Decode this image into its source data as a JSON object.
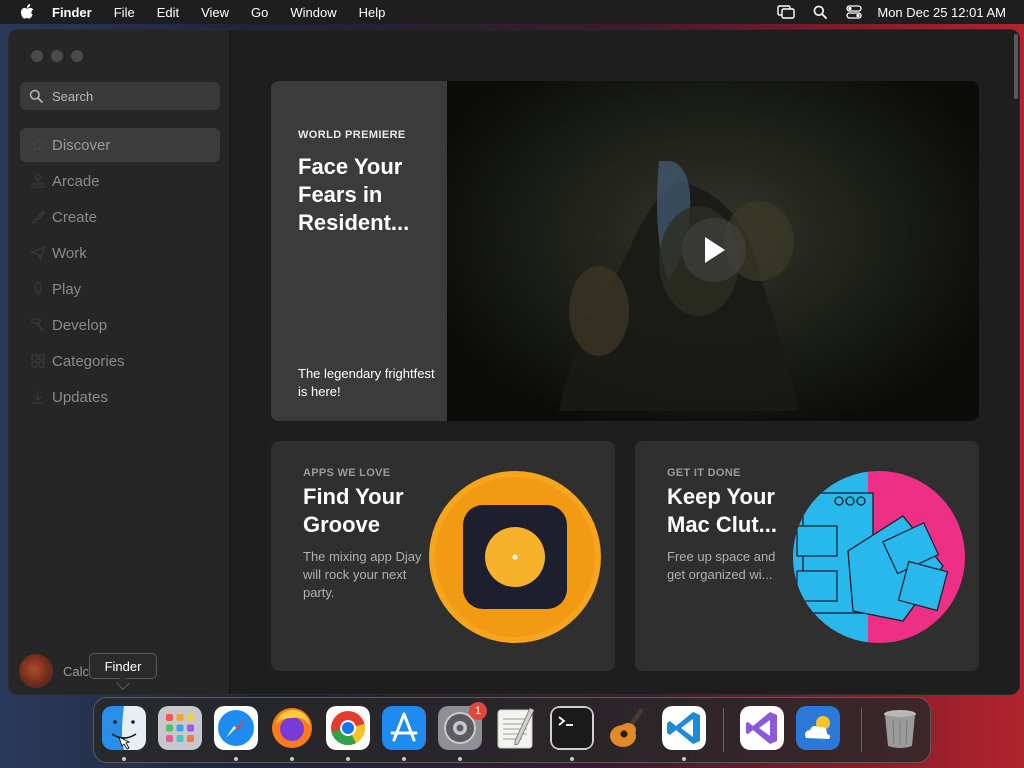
{
  "menubar": {
    "app_name": "Finder",
    "menus": [
      "File",
      "Edit",
      "View",
      "Go",
      "Window",
      "Help"
    ],
    "clock": "Mon Dec 25  12:01 AM",
    "status_icons": [
      "screen-mirroring-icon",
      "spotlight-search-icon",
      "control-center-icon"
    ]
  },
  "sidebar": {
    "search_placeholder": "Search",
    "items": [
      {
        "label": "Discover",
        "icon": "star-icon",
        "active": true
      },
      {
        "label": "Arcade",
        "icon": "joystick-icon",
        "active": false
      },
      {
        "label": "Create",
        "icon": "paintbrush-icon",
        "active": false
      },
      {
        "label": "Work",
        "icon": "paperplane-icon",
        "active": false
      },
      {
        "label": "Play",
        "icon": "rocket-icon",
        "active": false
      },
      {
        "label": "Develop",
        "icon": "hammer-icon",
        "active": false
      },
      {
        "label": "Categories",
        "icon": "grid-icon",
        "active": false
      },
      {
        "label": "Updates",
        "icon": "download-icon",
        "active": false
      }
    ],
    "user_name": "Calc"
  },
  "hero": {
    "eyebrow": "WORLD PREMIERE",
    "title": "Face Your Fears in Resident...",
    "subtitle": "The legendary frightfest is here!"
  },
  "cards": [
    {
      "eyebrow": "APPS WE LOVE",
      "title": "Find Your Groove",
      "subtitle": "The mixing app Djay will rock your next party."
    },
    {
      "eyebrow": "GET IT DONE",
      "title": "Keep Your Mac Clut...",
      "subtitle": "Free up space and get organized wi..."
    }
  ],
  "tooltip": "Finder",
  "dock": {
    "apps": [
      "Finder",
      "Launchpad",
      "Safari",
      "Firefox",
      "Chrome",
      "App Store",
      "System Settings",
      "TextEdit",
      "Terminal",
      "GarageBand",
      "Visual Studio Code",
      "Visual Studio",
      "Weather",
      "Trash"
    ],
    "settings_badge": "1"
  },
  "colors": {
    "window_bg": "#1e1e1e",
    "sidebar_bg": "#262626",
    "card_bg": "#2f2f2f",
    "accent_orange": "#f7a51c",
    "accent_pink": "#ee2f86",
    "accent_cyan": "#29b8ec"
  }
}
